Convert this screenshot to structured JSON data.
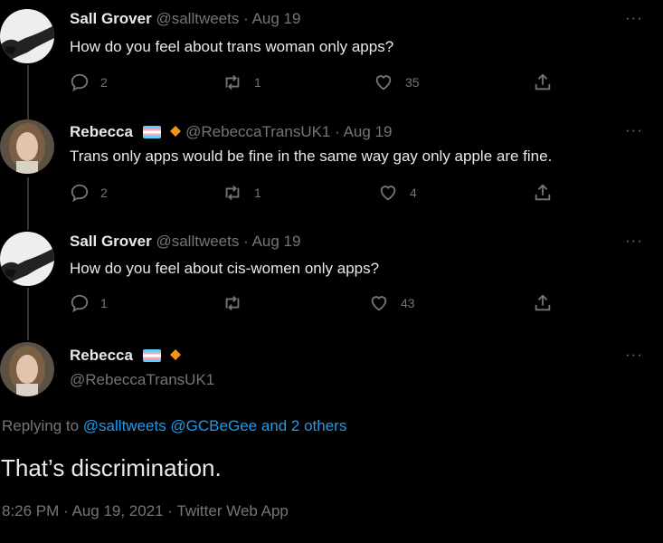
{
  "tweets": [
    {
      "name": "Sall Grover",
      "handle": "@salltweets",
      "date": "Aug 19",
      "text": "How do you feel about trans woman only apps?",
      "replies": "2",
      "retweets": "1",
      "likes": "35"
    },
    {
      "name": "Rebecca",
      "handle": "@RebeccaTransUK1",
      "date": "Aug 19",
      "text": "Trans only apps would be fine in the same way gay only apple are fine.",
      "replies": "2",
      "retweets": "1",
      "likes": "4"
    },
    {
      "name": "Sall Grover",
      "handle": "@salltweets",
      "date": "Aug 19",
      "text": "How do you feel about cis-women only apps?",
      "replies": "1",
      "retweets": "",
      "likes": "43"
    }
  ],
  "main_tweet": {
    "name": "Rebecca",
    "handle": "@RebeccaTransUK1",
    "replying_prefix": "Replying to",
    "replying_to": "@salltweets @GCBeGee and 2 others",
    "text": "That’s discrimination.",
    "meta": "8:26 PM · Aug 19, 2021 · Twitter Web App"
  },
  "separator": "·",
  "more_label": "···",
  "icons": {
    "reply": "reply-icon",
    "retweet": "retweet-icon",
    "like": "heart-icon",
    "share": "share-icon",
    "verified": "orange-diamond-badge",
    "flag": "trans-flag-emoji"
  },
  "colors": {
    "background": "#000000",
    "text": "#e7e9ea",
    "muted": "#71767b",
    "link": "#1d9bf0",
    "badge": "#f7931a"
  }
}
